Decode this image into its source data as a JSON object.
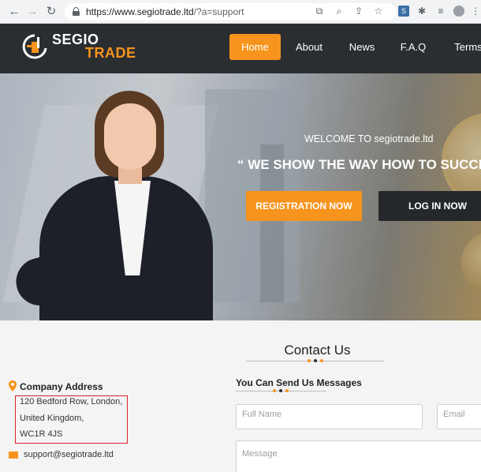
{
  "browser": {
    "url_host": "https://www.segiotrade.ltd",
    "url_path": "/?a=support"
  },
  "brand": {
    "name_line1": "SEGIO",
    "name_line2": "TRADE",
    "accent_color": "#f7941d",
    "header_color": "#2b2e31"
  },
  "nav": {
    "items": [
      {
        "label": "Home",
        "active": true
      },
      {
        "label": "About",
        "active": false
      },
      {
        "label": "News",
        "active": false
      },
      {
        "label": "F.A.Q",
        "active": false
      },
      {
        "label": "Terms",
        "active": false
      }
    ]
  },
  "hero": {
    "welcome": "WELCOME TO segiotrade.ltd",
    "tagline": "“ WE SHOW THE WAY HOW TO SUCCE",
    "register_label": "REGISTRATION NOW",
    "login_label": "LOG IN NOW"
  },
  "contact": {
    "title": "Contact Us",
    "address_title": "Company Address",
    "address_lines": [
      "120 Bedford Row, London,",
      "United Kingdom,",
      "WC1R 4JS"
    ],
    "email": "support@segiotrade.ltd",
    "form_title": "You Can Send Us Messages",
    "fullname_placeholder": "Full Name",
    "email_placeholder": "Email",
    "message_placeholder": "Message"
  },
  "icons": {
    "back": "arrow-left-icon",
    "forward": "arrow-right-icon",
    "reload": "reload-icon",
    "lock": "lock-icon",
    "pin": "map-pin-icon",
    "mail": "envelope-icon"
  }
}
